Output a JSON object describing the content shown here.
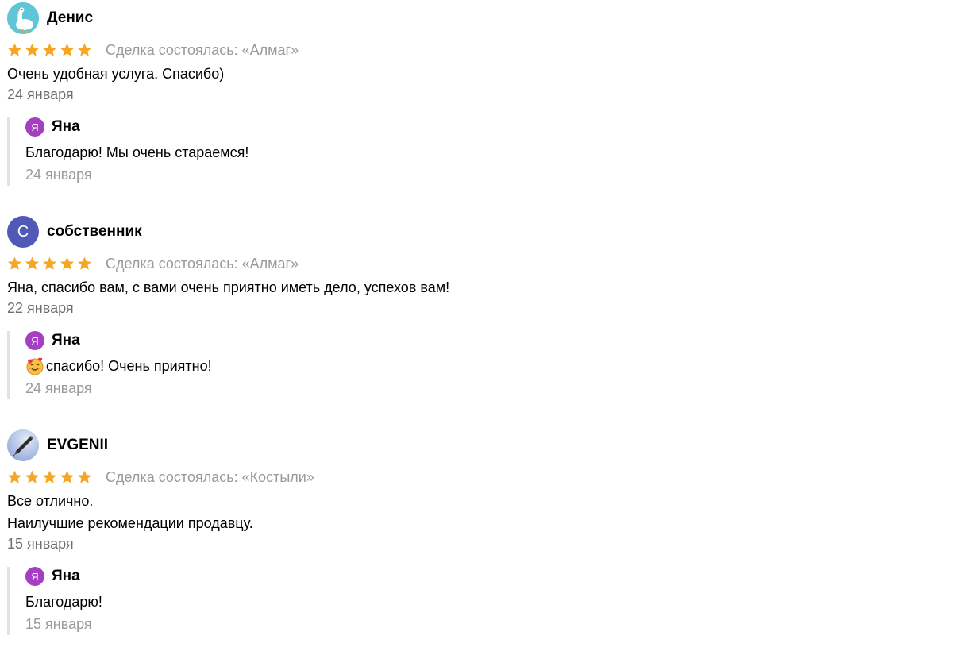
{
  "colors": {
    "star": "#f5a623",
    "deal_text": "#9a9a9a",
    "date_text": "#6f6f6f",
    "reply_border": "#e2e2e2",
    "reply_avatar_bg": "#a43fc2",
    "avatar_c_bg": "#5059b8"
  },
  "reviews": [
    {
      "name": "Денис",
      "avatar_icon": "goose-avatar-icon",
      "rating": 5,
      "deal": "Сделка состоялась: «Алмаг»",
      "lines": [
        "Очень удобная услуга. Спасибо)"
      ],
      "date": "24 января",
      "reply": {
        "avatar_letter": "Я",
        "name": "Яна",
        "text": "Благодарю! Мы очень стараемся!",
        "emoji": "",
        "date": "24 января"
      }
    },
    {
      "name": "собственник",
      "avatar_letter": "С",
      "rating": 5,
      "deal": "Сделка состоялась: «Алмаг»",
      "lines": [
        "Яна, спасибо вам, с вами очень приятно иметь дело, успехов вам!"
      ],
      "date": "22 января",
      "reply": {
        "avatar_letter": "Я",
        "name": "Яна",
        "text": "спасибо! Очень приятно!",
        "emoji": "smiling-face-with-hearts-emoji",
        "date": "24 января"
      }
    },
    {
      "name": "EVGENII",
      "avatar_icon": "pen-avatar-icon",
      "rating": 5,
      "deal": "Сделка состоялась: «Костыли»",
      "lines": [
        "Все отлично.",
        "Наилучшие рекомендации продавцу."
      ],
      "date": "15 января",
      "reply": {
        "avatar_letter": "Я",
        "name": "Яна",
        "text": "Благодарю!",
        "emoji": "",
        "date": "15 января"
      }
    }
  ]
}
